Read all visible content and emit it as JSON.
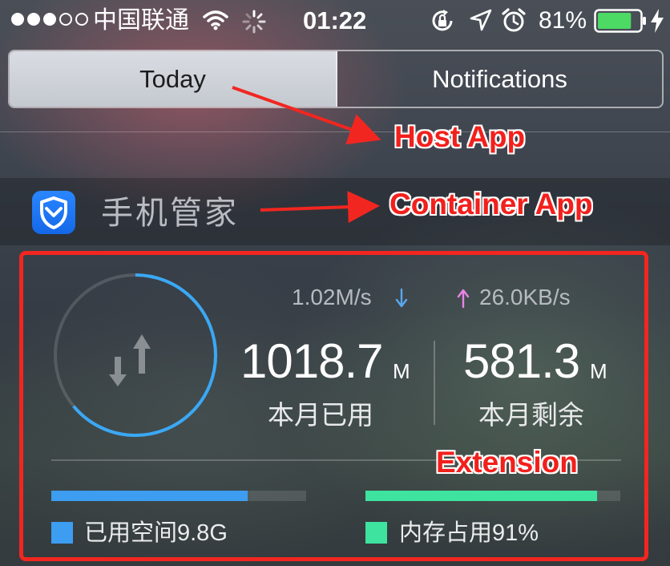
{
  "status_bar": {
    "carrier": "中国联通",
    "time": "01:22",
    "battery_percent": "81%",
    "battery_level": 0.81,
    "signal_bars_filled": 3,
    "signal_bars_total": 5,
    "icons": [
      "wifi-icon",
      "activity-spinner-icon",
      "rotation-lock-icon",
      "location-arrow-icon",
      "alarm-clock-icon",
      "battery-icon",
      "charging-bolt-icon"
    ]
  },
  "segmented_control": {
    "tabs": [
      {
        "label": "Today",
        "selected": true
      },
      {
        "label": "Notifications",
        "selected": false
      }
    ]
  },
  "widget": {
    "app_name": "手机管家",
    "app_icon": "shield-check-icon",
    "download_speed": "1.02M/s",
    "upload_speed": "26.0KB/s",
    "used": {
      "value": "1018.7",
      "unit": "M",
      "label": "本月已用"
    },
    "remaining": {
      "value": "581.3",
      "unit": "M",
      "label": "本月剩余"
    },
    "ring_progress": 0.64,
    "storage": {
      "label": "已用空间9.8G",
      "fraction": 0.77,
      "color": "#3c9df1"
    },
    "memory": {
      "label": "内存占用91%",
      "fraction": 0.91,
      "color": "#3ee3a0"
    }
  },
  "annotations": {
    "host_app": "Host App",
    "container_app": "Container App",
    "extension": "Extension",
    "color": "#f22620"
  }
}
